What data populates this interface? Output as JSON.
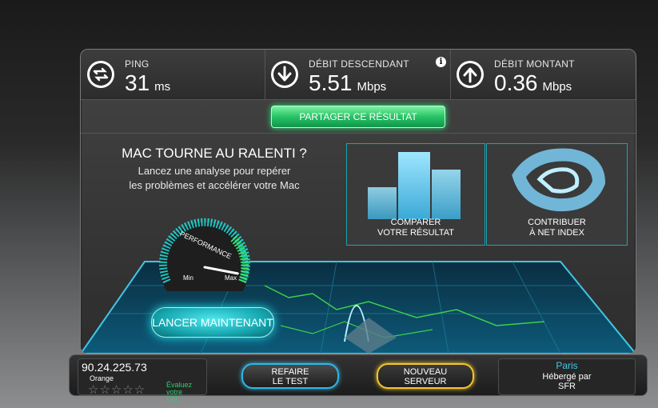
{
  "stats": [
    {
      "label": "PING",
      "value": "31",
      "unit": "ms",
      "icon": "ping-arrows-icon"
    },
    {
      "label": "DÉBIT DESCENDANT",
      "value": "5.51",
      "unit": "Mbps",
      "icon": "download-arrow-icon"
    },
    {
      "label": "DÉBIT MONTANT",
      "value": "0.36",
      "unit": "Mbps",
      "icon": "upload-arrow-icon"
    }
  ],
  "info_icon": "i",
  "share_label": "PARTAGER CE RÉSULTAT",
  "promo": {
    "title": "MAC TOURNE AU RALENTI ?",
    "subtitle_line1": "Lancez une analyse pour repérer",
    "subtitle_line2": "les problèmes et accélérer votre Mac",
    "gauge_label": "PERFORMANCE",
    "gauge_min": "Min",
    "gauge_max": "Max",
    "gauge_level": 0.92,
    "launch_label": "LANCER MAINTENANT"
  },
  "cards": [
    {
      "line1": "COMPARER",
      "line2": "VOTRE RÉSULTAT"
    },
    {
      "line1": "CONTRIBUER",
      "line2": "À NET INDEX"
    }
  ],
  "client": {
    "ip": "90.24.225.73",
    "isp": "Orange",
    "stars": "☆☆☆☆☆",
    "rate_line1": "Évaluez votre",
    "rate_line2": "FAI"
  },
  "buttons": {
    "retest_line1": "REFAIRE",
    "retest_line2": "LE TEST",
    "newserver_line1": "NOUVEAU",
    "newserver_line2": "SERVEUR"
  },
  "server": {
    "city": "Paris",
    "hosted_line1": "Hébergé par",
    "hosted_line2": "SFR"
  },
  "colors": {
    "accent_teal": "#1fe0e8",
    "share_green": "#27c266",
    "retest_blue": "#2fb7e6",
    "newserver_gold": "#f5c52b",
    "map_border_green": "#3ad14a"
  }
}
